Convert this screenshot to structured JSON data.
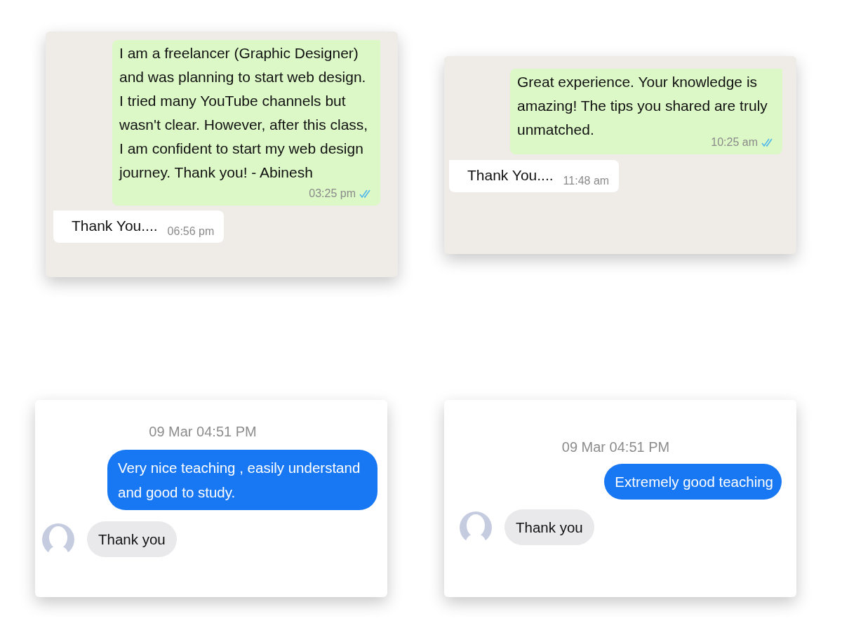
{
  "cards": [
    {
      "kind": "whatsapp",
      "messages": [
        {
          "kind": "sent",
          "text": "I am a freelancer (Graphic Designer) and was planning to start web design. I tried many YouTube channels but wasn't clear. However, after this class, I am confident to start my web design journey. Thank you! - Abinesh",
          "time": "03:25 pm",
          "read": true
        },
        {
          "kind": "received",
          "text": "Thank You....",
          "time": "06:56 pm"
        }
      ]
    },
    {
      "kind": "whatsapp",
      "messages": [
        {
          "kind": "sent",
          "text": "Great experience. Your knowledge is amazing! The tips you shared are truly unmatched.",
          "time": "10:25 am",
          "read": true
        },
        {
          "kind": "received",
          "text": "Thank You....",
          "time": "11:48 am"
        }
      ]
    },
    {
      "kind": "messenger",
      "timestamp": "09 Mar 04:51 PM",
      "messages": [
        {
          "kind": "sent",
          "text": "Very nice teaching , easily understand and good to study."
        },
        {
          "kind": "received",
          "text": "Thank you"
        }
      ]
    },
    {
      "kind": "messenger",
      "timestamp": "09 Mar 04:51 PM",
      "messages": [
        {
          "kind": "sent",
          "text": "Extremely good teaching"
        },
        {
          "kind": "received",
          "text": "Thank you"
        }
      ]
    }
  ]
}
